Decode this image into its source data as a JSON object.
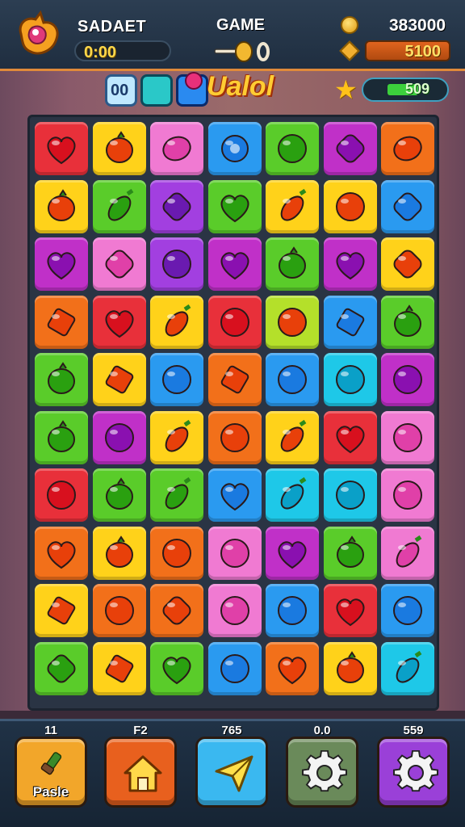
{
  "header": {
    "left_title": "SADAET",
    "timer": "0:00",
    "center_title": "GAME",
    "coins": "383000",
    "score": "5100"
  },
  "hud": {
    "logo_text": "Ualol",
    "moves": "509",
    "moves_fill": 0.35
  },
  "board": {
    "cols": 7,
    "rows": 10,
    "colors": {
      "red": "#e8303a",
      "yellow": "#ffd21a",
      "pink": "#f07ad2",
      "blue": "#2a9af0",
      "green": "#5acc2a",
      "magenta": "#c030c8",
      "orange": "#f2701a",
      "violet": "#a23fe0",
      "cyan": "#1ec8e8",
      "lime": "#b4e02a"
    },
    "tiles": [
      [
        "red",
        "yellow",
        "pink",
        "blue",
        "green",
        "magenta",
        "orange"
      ],
      [
        "yellow",
        "green",
        "violet",
        "green",
        "yellow",
        "yellow",
        "blue"
      ],
      [
        "magenta",
        "pink",
        "violet",
        "magenta",
        "green",
        "magenta",
        "yellow"
      ],
      [
        "orange",
        "red",
        "yellow",
        "red",
        "lime",
        "blue",
        "green"
      ],
      [
        "green",
        "yellow",
        "blue",
        "orange",
        "blue",
        "cyan",
        "magenta"
      ],
      [
        "green",
        "magenta",
        "yellow",
        "orange",
        "yellow",
        "red",
        "pink"
      ],
      [
        "red",
        "green",
        "green",
        "blue",
        "cyan",
        "cyan",
        "pink"
      ],
      [
        "orange",
        "yellow",
        "orange",
        "pink",
        "magenta",
        "green",
        "pink"
      ],
      [
        "yellow",
        "orange",
        "orange",
        "pink",
        "blue",
        "red",
        "blue"
      ],
      [
        "green",
        "yellow",
        "green",
        "blue",
        "orange",
        "yellow",
        "cyan"
      ]
    ],
    "candies": [
      [
        "heart",
        "berry",
        "lemon",
        "flower",
        "blob",
        "drop",
        "lemon"
      ],
      [
        "berry",
        "pepper",
        "drop",
        "heart",
        "pepper",
        "blob",
        "drop"
      ],
      [
        "heart",
        "drop",
        "blob",
        "heart",
        "berry",
        "heart",
        "drop"
      ],
      [
        "diamond",
        "heart",
        "pepper",
        "blob",
        "blob",
        "diamond",
        "berry"
      ],
      [
        "berry",
        "diamond",
        "blob",
        "diamond",
        "blob",
        "blob",
        "blob"
      ],
      [
        "berry",
        "blob",
        "pepper",
        "blob",
        "pepper",
        "heart",
        "blob"
      ],
      [
        "blob",
        "berry",
        "pepper",
        "heart",
        "pepper",
        "blob",
        "blob"
      ],
      [
        "heart",
        "berry",
        "blob",
        "blob",
        "heart",
        "berry",
        "pepper"
      ],
      [
        "diamond",
        "blob",
        "drop",
        "blob",
        "blob",
        "heart",
        "blob"
      ],
      [
        "drop",
        "diamond",
        "heart",
        "blob",
        "heart",
        "berry",
        "pepper"
      ]
    ]
  },
  "bottom": {
    "buttons": [
      {
        "top_label": "11",
        "text": "Pasle",
        "icon": "brush-icon",
        "color": "#f2a62a"
      },
      {
        "top_label": "F2",
        "text": "",
        "icon": "home-icon",
        "color": "#e8601e"
      },
      {
        "top_label": "765",
        "text": "",
        "icon": "send-icon",
        "color": "#3ab8f0"
      },
      {
        "top_label": "0.0",
        "text": "",
        "icon": "gear-icon",
        "color": "#6a8a5a"
      },
      {
        "top_label": "559",
        "text": "",
        "icon": "settings-gear-icon",
        "color": "#9a40d8"
      }
    ]
  }
}
